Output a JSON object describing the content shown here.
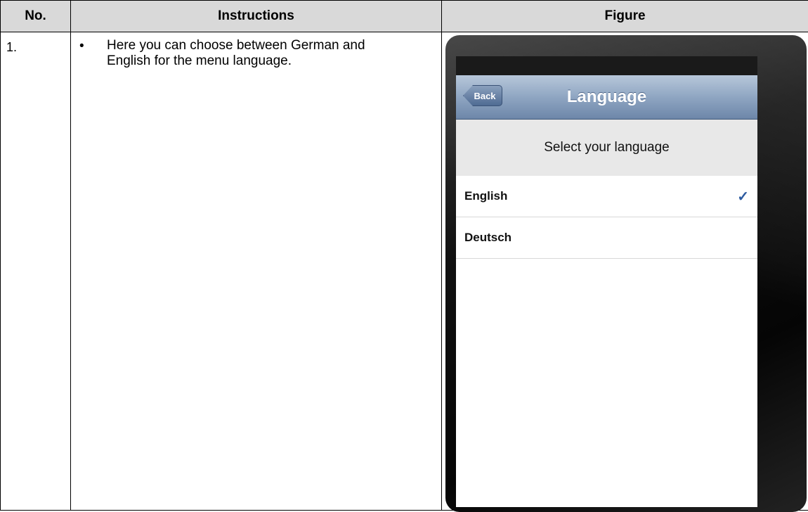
{
  "table": {
    "headers": {
      "no": "No.",
      "instructions": "Instructions",
      "figure": "Figure"
    },
    "rows": [
      {
        "no": "1.",
        "bullet": "•",
        "instruction": "Here you can choose between German and English for the menu language."
      }
    ]
  },
  "figure": {
    "navbar": {
      "back_label": "Back",
      "title": "Language"
    },
    "section_header": "Select your language",
    "languages": [
      {
        "label": "English",
        "selected": true,
        "check": "✓"
      },
      {
        "label": "Deutsch",
        "selected": false,
        "check": ""
      }
    ],
    "icons": {
      "selected_indicator": "check-icon"
    },
    "colors": {
      "navbar": "#8fa6c2",
      "checkmark": "#2d5ba0"
    }
  }
}
